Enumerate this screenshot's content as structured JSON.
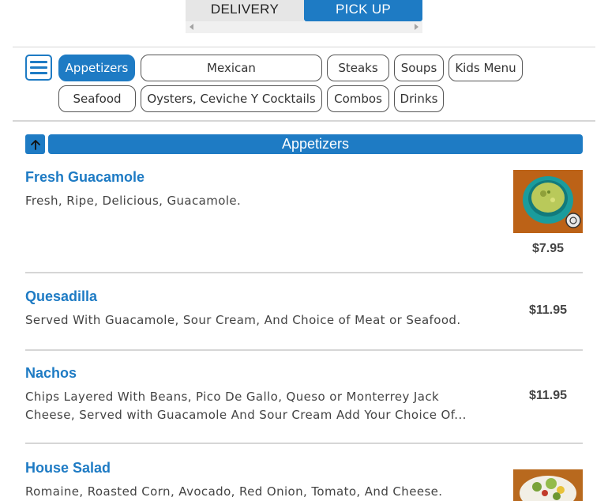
{
  "order_mode": {
    "delivery_label": "DELIVERY",
    "pickup_label": "PICK UP",
    "selected": "PICK UP"
  },
  "categories": [
    {
      "label": "Appetizers",
      "active": true
    },
    {
      "label": "Mexican",
      "active": false
    },
    {
      "label": "Steaks",
      "active": false
    },
    {
      "label": "Soups",
      "active": false
    },
    {
      "label": "Kids Menu",
      "active": false
    },
    {
      "label": "Seafood",
      "active": false
    },
    {
      "label": "Oysters, Ceviche Y Cocktails",
      "active": false
    },
    {
      "label": "Combos",
      "active": false
    },
    {
      "label": "Drinks",
      "active": false
    }
  ],
  "section": {
    "title": "Appetizers"
  },
  "items": [
    {
      "name": "Fresh Guacamole",
      "description": "Fresh, Ripe, Delicious, Guacamole.",
      "price": "$7.95",
      "has_image": true,
      "image_icon": "guacamole-photo"
    },
    {
      "name": "Quesadilla",
      "description": "Served With Guacamole, Sour Cream, And Choice of Meat or Seafood.",
      "price": "$11.95",
      "has_image": false
    },
    {
      "name": "Nachos",
      "description": "Chips Layered With Beans, Pico De Gallo, Queso or Monterrey Jack Cheese, Served with Guacamole And Sour Cream Add Your Choice Of...",
      "price": "$11.95",
      "has_image": false
    },
    {
      "name": "House Salad",
      "description": "Romaine, Roasted Corn, Avocado, Red Onion, Tomato, And Cheese.",
      "price": "",
      "has_image": true,
      "image_icon": "salad-photo"
    }
  ],
  "colors": {
    "accent": "#1e7bc4",
    "divider": "#d6d6d6"
  }
}
